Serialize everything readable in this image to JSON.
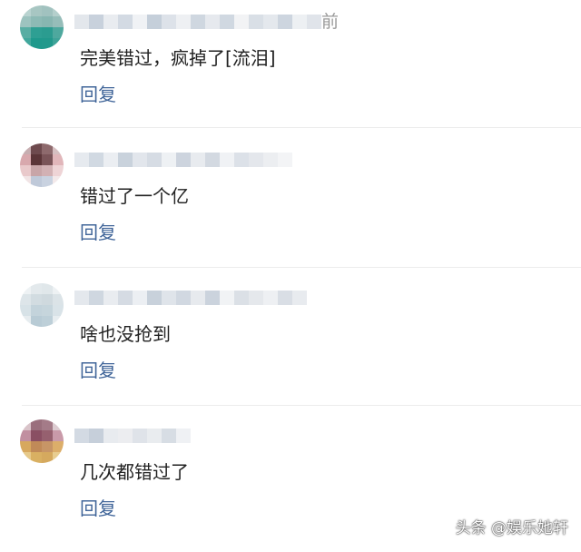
{
  "comments": [
    {
      "text": "完美错过，疯掉了[流泪]",
      "reply_label": "回复",
      "time_tail": "前"
    },
    {
      "text": "错过了一个亿",
      "reply_label": "回复"
    },
    {
      "text": "啥也没抢到",
      "reply_label": "回复"
    },
    {
      "text": "几次都错过了",
      "reply_label": "回复"
    }
  ],
  "watermark": "头条 @娱乐她轩",
  "colors": {
    "reply_link": "#406599",
    "comment_text": "#222222",
    "divider": "#ececec"
  }
}
